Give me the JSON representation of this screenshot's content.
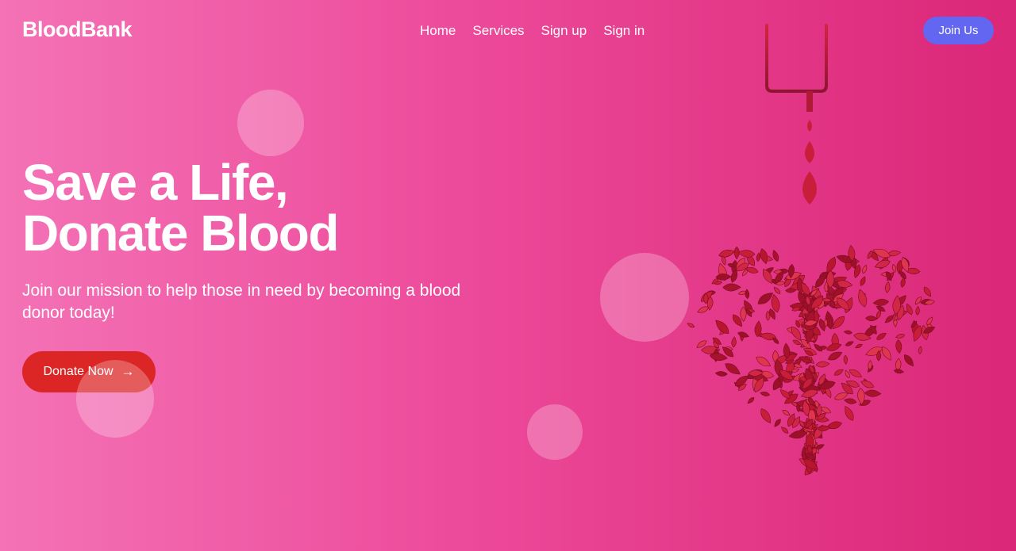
{
  "brand": {
    "logo_text": "BloodBank"
  },
  "nav": {
    "items": [
      {
        "label": "Home"
      },
      {
        "label": "Services"
      },
      {
        "label": "Sign up"
      },
      {
        "label": "Sign in"
      }
    ],
    "cta_label": "Join Us"
  },
  "hero": {
    "title_line1": "Save a Life,",
    "title_line2": "Donate Blood",
    "subtitle": "Join our mission to help those in need by becoming a blood donor today!",
    "button_label": "Donate Now",
    "button_icon": "arrow-right-icon"
  },
  "colors": {
    "gradient_start": "#f472b6",
    "gradient_end": "#db2777",
    "join_button": "#6366f1",
    "donate_button": "#dc2626",
    "blood": "#c81e3a"
  }
}
